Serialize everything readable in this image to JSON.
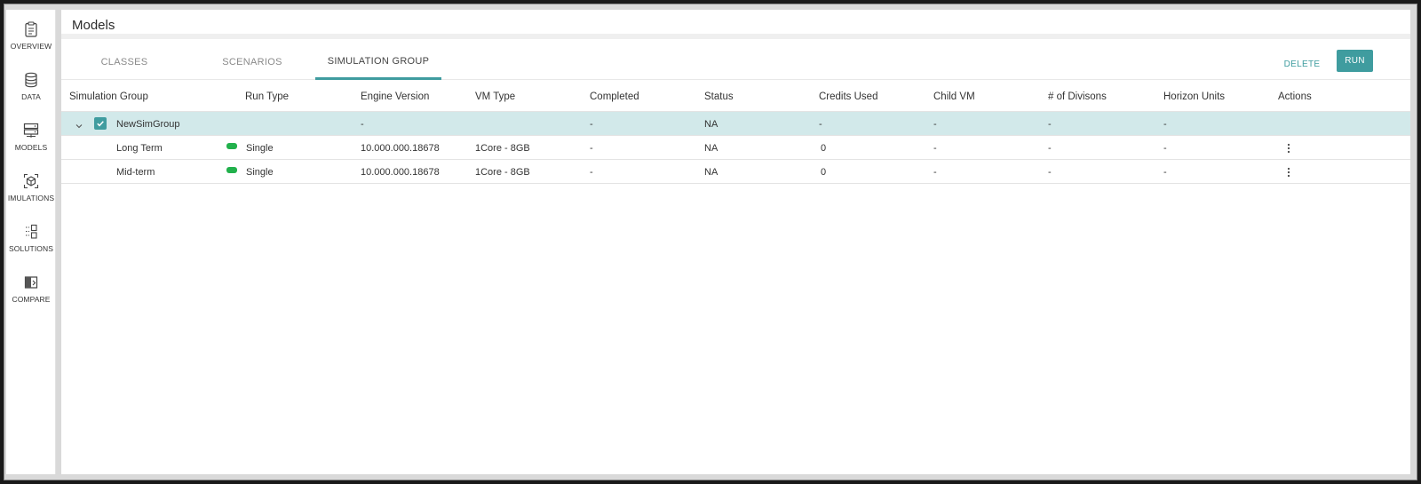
{
  "sidebar": {
    "items": [
      {
        "label": "OVERVIEW",
        "icon": "clipboard-icon"
      },
      {
        "label": "DATA",
        "icon": "database-icon"
      },
      {
        "label": "MODELS",
        "icon": "server-icon"
      },
      {
        "label": "IMULATIONS",
        "icon": "cube-icon"
      },
      {
        "label": "SOLUTIONS",
        "icon": "solutions-icon"
      },
      {
        "label": "COMPARE",
        "icon": "compare-icon"
      }
    ]
  },
  "header": {
    "title": "Models"
  },
  "tabs": [
    {
      "label": "CLASSES"
    },
    {
      "label": "SCENARIOS"
    },
    {
      "label": "SIMULATION GROUP",
      "active": true
    }
  ],
  "actions": {
    "delete_label": "DELETE",
    "run_label": "RUN"
  },
  "table": {
    "columns": [
      "Simulation Group",
      "Run Type",
      "Engine Version",
      "VM Type",
      "Completed",
      "Status",
      "Credits Used",
      "Child VM",
      "# of Divisons",
      "Horizon Units",
      "Actions"
    ],
    "group": {
      "name": "NewSimGroup",
      "engine_version": "-",
      "completed": "-",
      "status": "NA",
      "credits_used": "-",
      "child_vm": "-",
      "divisions": "-",
      "horizon_units": "-"
    },
    "rows": [
      {
        "name": "Long Term",
        "run_type": "Single",
        "engine_version": "10.000.000.18678",
        "vm_type": "1Core - 8GB",
        "completed": "-",
        "status": "NA",
        "credits_used": "0",
        "child_vm": "-",
        "divisions": "-",
        "horizon_units": "-"
      },
      {
        "name": "Mid-term",
        "run_type": "Single",
        "engine_version": "10.000.000.18678",
        "vm_type": "1Core - 8GB",
        "completed": "-",
        "status": "NA",
        "credits_used": "0",
        "child_vm": "-",
        "divisions": "-",
        "horizon_units": "-"
      }
    ]
  },
  "colors": {
    "accent": "#3f9c9f",
    "group_row": "#d2e9ea",
    "status_ok": "#22b14c"
  }
}
